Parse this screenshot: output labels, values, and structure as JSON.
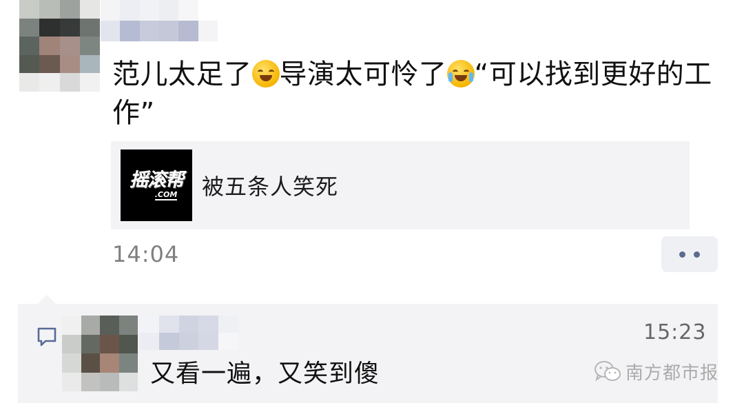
{
  "post": {
    "avatar_mosaic": [
      "#c8cbc6",
      "#b9bdb8",
      "#9ea29e",
      "#e6e7e5",
      "#7c837f",
      "#2e3030",
      "#383a39",
      "#6e7571",
      "#5c645f",
      "#a08479",
      "#a8908a",
      "#7e8681",
      "#545a52",
      "#6b5a50",
      "#a78d83",
      "#a9b6bc",
      "#e9eae8",
      "#f0efef",
      "#d9d9d9",
      "#f1f1f1"
    ],
    "name_mosaic": [
      "#f4f4f6",
      "#eceef3",
      "#f1f2f6",
      "#edeef2",
      "#f6f6f8",
      "#ffffff",
      "#e3e5ee",
      "#b5bbd2",
      "#c7cbdc",
      "#c4c8d8",
      "#b6bbd2",
      "#f4f4f6"
    ],
    "text_part1": "范儿太足了",
    "emoji1": "thinking-emoji",
    "text_part2": "导演太可怜了",
    "emoji2": "crying-emoji",
    "text_part3": "“可以找到更好的工作”",
    "link": {
      "thumb_brand": "摇滚帮",
      "thumb_domain": ".COM",
      "title": "被五条人笑死"
    },
    "time": "14:04"
  },
  "comment": {
    "avatar_mosaic": [
      "#eff0ef",
      "#a7aaa6",
      "#5a5e59",
      "#7c827d",
      "#c9ccc8",
      "#646a61",
      "#6b5448",
      "#51574e",
      "#d6d8d5",
      "#5a5045",
      "#a78677",
      "#7b8480",
      "#eaeaea",
      "#c2c2c0",
      "#b8bbb9",
      "#dedfdf"
    ],
    "name_mosaic": [
      "#f2f3f6",
      "#e0e3ec",
      "#d0d4e2",
      "#d7dae6",
      "#eef0f4",
      "#ecedf2",
      "#c5cadb",
      "#ccd0df",
      "#d5d8e4",
      "#f6f6f8"
    ],
    "time": "15:23",
    "text": "又看一遍，又笑到傻"
  },
  "watermark": {
    "text": "南方都市报",
    "icon": "wechat-icon"
  },
  "colors": {
    "card_bg": "#f3f3f5",
    "more_dots": "#5a6b8c",
    "comment_icon": "#576b95"
  }
}
